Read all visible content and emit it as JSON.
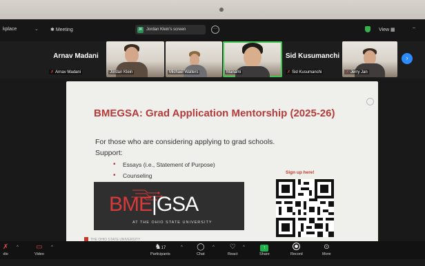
{
  "topbar": {
    "workplace_label": "kplace",
    "meeting_label": "Meeting",
    "screen_badge": "JK",
    "screen_label": "Jordan Klein's screen",
    "view_label": "View",
    "more_glyph": "···",
    "minimize_glyph": "–"
  },
  "gallery": {
    "tiles": [
      {
        "big_name": "Arnav Madani",
        "label": "Arnav Madani",
        "muted": true
      },
      {
        "label": "Jordan Klein"
      },
      {
        "label": "Michael Walters"
      },
      {
        "label": "Manami"
      },
      {
        "big_name": "Sid Kusumanchi",
        "label": "Sid Kusumanchi",
        "muted": true
      },
      {
        "label": "Jerry Jan",
        "muted": true
      }
    ],
    "next_glyph": "›"
  },
  "slide": {
    "title": "BMEGSA: Grad Application Mentorship (2025-26)",
    "subtitle": "For those who are considering applying to grad schools.",
    "support_label": "Support:",
    "bullets": [
      "Essays (i.e., Statement of Purpose)",
      "Counseling"
    ],
    "signup": "Sign up here!",
    "logo_bme": "BME",
    "logo_gsa": "GSA",
    "logo_sub": "AT THE OHIO STATE UNIVERSITY",
    "footer": "THE OHIO STATE UNIVERSITY"
  },
  "toolbar": {
    "audio_label": "dio",
    "video_label": "Video",
    "participants_label": "Participants",
    "participants_count": "17",
    "chat_label": "Chat",
    "react_label": "React",
    "share_label": "Share",
    "record_label": "Record",
    "more_label": "More"
  },
  "colors": {
    "accent_red": "#b53a3a",
    "active_speaker": "#3fc651",
    "share_green": "#1fb24a",
    "zoom_blue": "#2d8cff"
  }
}
